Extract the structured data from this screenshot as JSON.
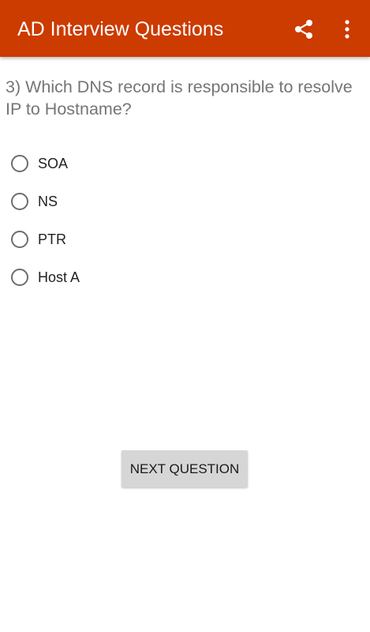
{
  "app_bar": {
    "title": "AD Interview Questions",
    "background_color": "#cc3b00",
    "share_icon": "share-icon",
    "overflow_icon": "more-vert-icon"
  },
  "question": {
    "text": "3) Which DNS record is responsible to resolve IP to Hostname?"
  },
  "options": [
    {
      "label": "SOA",
      "selected": false
    },
    {
      "label": "NS",
      "selected": false
    },
    {
      "label": "PTR",
      "selected": false
    },
    {
      "label": "Host A",
      "selected": false
    }
  ],
  "next_button": {
    "label": "NEXT QUESTION"
  }
}
